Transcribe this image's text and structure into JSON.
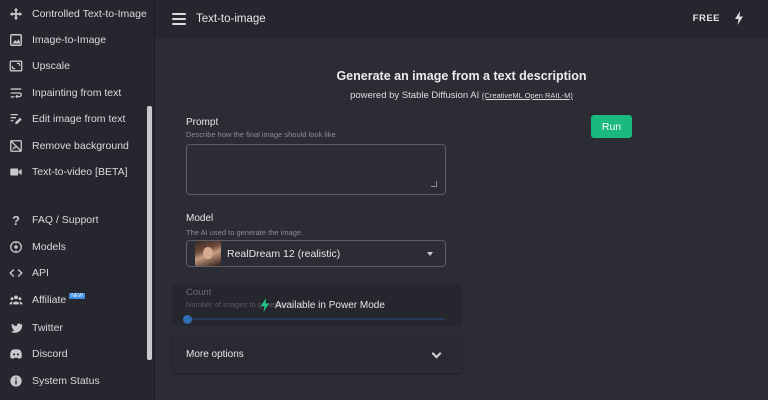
{
  "sidebar": {
    "items": [
      {
        "label": "Controlled Text-to-Image",
        "icon": "move-icon"
      },
      {
        "label": "Image-to-Image",
        "icon": "image-icon"
      },
      {
        "label": "Upscale",
        "icon": "upscale-icon"
      },
      {
        "label": "Inpainting from text",
        "icon": "wrap-text-icon"
      },
      {
        "label": "Edit image from text",
        "icon": "edit-text-icon"
      },
      {
        "label": "Remove background",
        "icon": "remove-bg-icon"
      },
      {
        "label": "Text-to-video [BETA]",
        "icon": "video-icon"
      },
      {
        "label": "FAQ / Support",
        "icon": "question-icon"
      },
      {
        "label": "Models",
        "icon": "models-icon"
      },
      {
        "label": "API",
        "icon": "code-icon"
      },
      {
        "label": "Affiliate",
        "icon": "group-icon",
        "badge": "NEW"
      },
      {
        "label": "Twitter",
        "icon": "twitter-icon"
      },
      {
        "label": "Discord",
        "icon": "discord-icon"
      },
      {
        "label": "System Status",
        "icon": "info-icon"
      }
    ]
  },
  "header": {
    "title": "Text-to-image",
    "plan": "FREE",
    "plan_icon": "bolt-icon"
  },
  "main": {
    "heading": "Generate an image from a text description",
    "subheading": "powered by Stable Diffusion AI",
    "license_link": "(CreativeML Open RAIL-M)",
    "prompt": {
      "label": "Prompt",
      "hint": "Describe how the final image should look like",
      "value": ""
    },
    "run_label": "Run",
    "model": {
      "label": "Model",
      "hint": "The AI used to generate the image.",
      "selected": "RealDream 12 (realistic)"
    },
    "count": {
      "label": "Count",
      "hint": "Number of images to generate",
      "locked_note": "Available in Power Mode"
    },
    "more_options_label": "More options"
  },
  "colors": {
    "background": "#2c2c34",
    "sidebar": "#26262e",
    "run_button": "#1ab97e",
    "bolt": "#1ecb86",
    "badge": "#3f8ee6"
  }
}
